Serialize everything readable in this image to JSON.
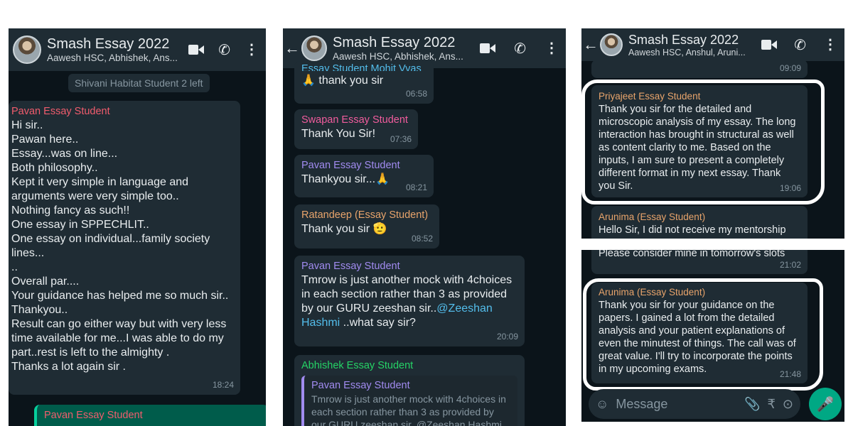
{
  "colors": {
    "bg": "#0b141a",
    "header": "#1f2c34",
    "bubble": "#1f2c34",
    "accent": "#00a884",
    "link": "#53bdeb"
  },
  "panel1": {
    "header": {
      "title": "Smash Essay 2022",
      "subtitle": "Aawesh HSC, Abhishek, Ans..."
    },
    "system": "Shivani Habitat Student 2 left",
    "msg1": {
      "sender": "Pavan Essay Student",
      "lines": [
        "Hi sir..",
        "Pawan here..",
        "Essay...was on line...",
        "Both philosophy..",
        "Kept it very simple in language and arguments were very simple too..",
        "Nothing fancy as such!!",
        "One essay in SPPECHLIT..",
        "One essay on individual...family society lines...",
        "..",
        "Overall par....",
        "Your guidance has helped me so much sir..",
        "Thankyou..",
        "Result can go either way but with very less time available for me...I was able to do my part..rest is left to the almighty .",
        "Thanks a lot again sir ."
      ],
      "time": "18:24"
    },
    "msg2": {
      "sender": "Pavan Essay Student"
    }
  },
  "panel2": {
    "header": {
      "title": "Smash Essay 2022",
      "subtitle": "Aawesh HSC, Abhishek, Ans..."
    },
    "m1": {
      "sender": "Essay Student Mohit Vyas",
      "emoji": "🙏",
      "text": "thank you sir",
      "time": "06:58"
    },
    "m2": {
      "sender": "Swapan Essay Student",
      "text": "Thank You Sir!",
      "time": "07:36"
    },
    "m3": {
      "sender": "Pavan Essay Student",
      "text": "Thankyou sir...",
      "emoji": "🙏",
      "time": "08:21"
    },
    "m4": {
      "sender": "Ratandeep (Essay Student)",
      "text": "Thank you sir",
      "emoji": "🫡",
      "time": "08:52"
    },
    "m5": {
      "sender": "Pavan Essay Student",
      "text": "Tmrow is just another mock with 4choices in each section rather than 3 as provided by our GURU zeeshan sir..",
      "mention": "@Zeeshan Hashmi",
      "tail": " ..what say sir?",
      "time": "20:09"
    },
    "m6": {
      "sender": "Abhishek Essay Student",
      "quote_sender": "Pavan Essay Student",
      "quote_text": "Tmrow is just another mock with 4choices in each section rather than 3 as provided by our GURU zeeshan sir..@Zeeshan Hashmi ..what..."
    }
  },
  "panel3": {
    "header": {
      "title": "Smash Essay 2022",
      "subtitle": "Aawesh HSC, Anshul, Aruni..."
    },
    "prev_time": "09:09",
    "m1": {
      "sender": "Priyajeet Essay Student",
      "text": "Thank you sir for the detailed and microscopic analysis of my essay. The long interaction has brought in structural as well as content clarity to me. Based on the inputs, I am sure to present a completely different format in my next essay. Thank you Sir.",
      "time": "19:06"
    },
    "m2": {
      "sender": "Arunima (Essay Student)",
      "text": "Hello Sir, I did not receive my mentorship"
    }
  },
  "panel4": {
    "prev_text": "Please consider mine in tomorrow's slots",
    "prev_time": "21:02",
    "m1": {
      "sender": "Arunima (Essay Student)",
      "text": "Thank you sir for your guidance on the papers. I gained a lot from the detailed analysis and your patient explanations of even the minutest of things.  The call was of great value. I'll try to incorporate the points in my upcoming exams.",
      "time": "21:48"
    },
    "input": {
      "placeholder": "Message"
    }
  }
}
